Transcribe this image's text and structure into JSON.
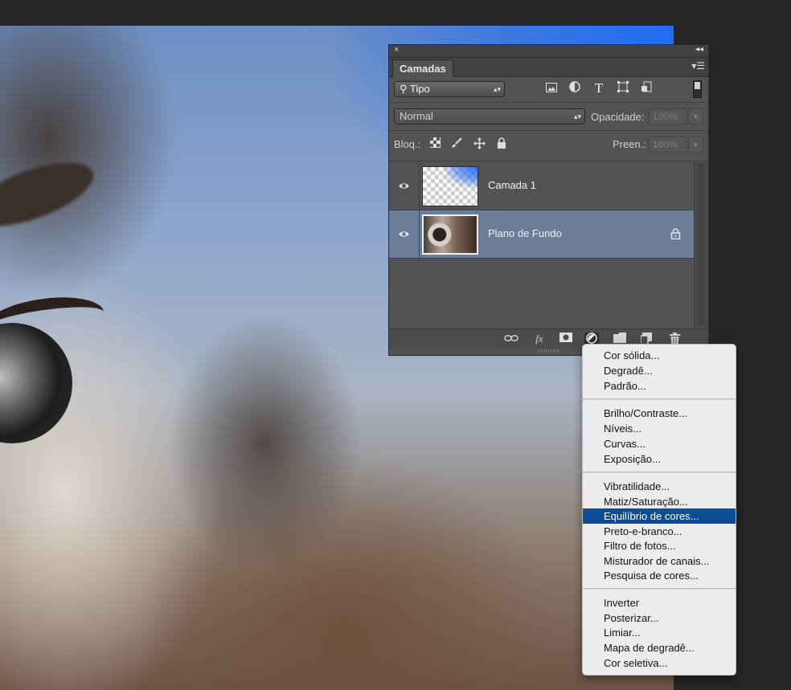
{
  "panel": {
    "title": "Camadas",
    "close_symbol": "×",
    "collapse_symbol": "◂◂",
    "menu_symbol": "▾☰",
    "filter": {
      "kind_label": "Tipo",
      "icons": [
        "image-filter-icon",
        "adjustment-filter-icon",
        "type-filter-icon",
        "shape-filter-icon",
        "smart-object-filter-icon"
      ],
      "type_icon_glyph": "T"
    },
    "blend": {
      "mode": "Normal",
      "opacity_label": "Opacidade:",
      "opacity_value": "100%"
    },
    "lock": {
      "label": "Bloq.:",
      "fill_label": "Preen.:",
      "fill_value": "100%"
    },
    "layers": [
      {
        "name": "Camada 1",
        "visible": true,
        "selected": false,
        "locked": false,
        "thumb": "transparent-blue"
      },
      {
        "name": "Plano de Fundo",
        "visible": true,
        "selected": true,
        "locked": true,
        "thumb": "photo"
      }
    ],
    "bottom": {
      "fx_label": "fx",
      "icons": [
        "link-layers-icon",
        "fx-icon",
        "add-mask-icon",
        "adjustment-layer-icon",
        "new-group-icon",
        "new-layer-icon",
        "delete-layer-icon"
      ]
    }
  },
  "menu": {
    "groups": [
      [
        "Cor sólida...",
        "Degradê...",
        "Padrão..."
      ],
      [
        "Brilho/Contraste...",
        "Níveis...",
        "Curvas...",
        "Exposição..."
      ],
      [
        "Vibratilidade...",
        "Matiz/Saturação...",
        "Equilíbrio de cores...",
        "Preto-e-branco...",
        "Filtro de fotos...",
        "Misturador de canais...",
        "Pesquisa de cores..."
      ],
      [
        "Inverter",
        "Posterizar...",
        "Limiar...",
        "Mapa de degradê...",
        "Cor seletiva..."
      ]
    ],
    "highlighted": "Equilíbrio de cores...",
    "colors": {
      "highlight": "#0a4d95",
      "background": "#ececec"
    }
  },
  "colors": {
    "panel_bg": "#535353",
    "selected_layer": "#6b7d97",
    "workspace": "#262626"
  }
}
